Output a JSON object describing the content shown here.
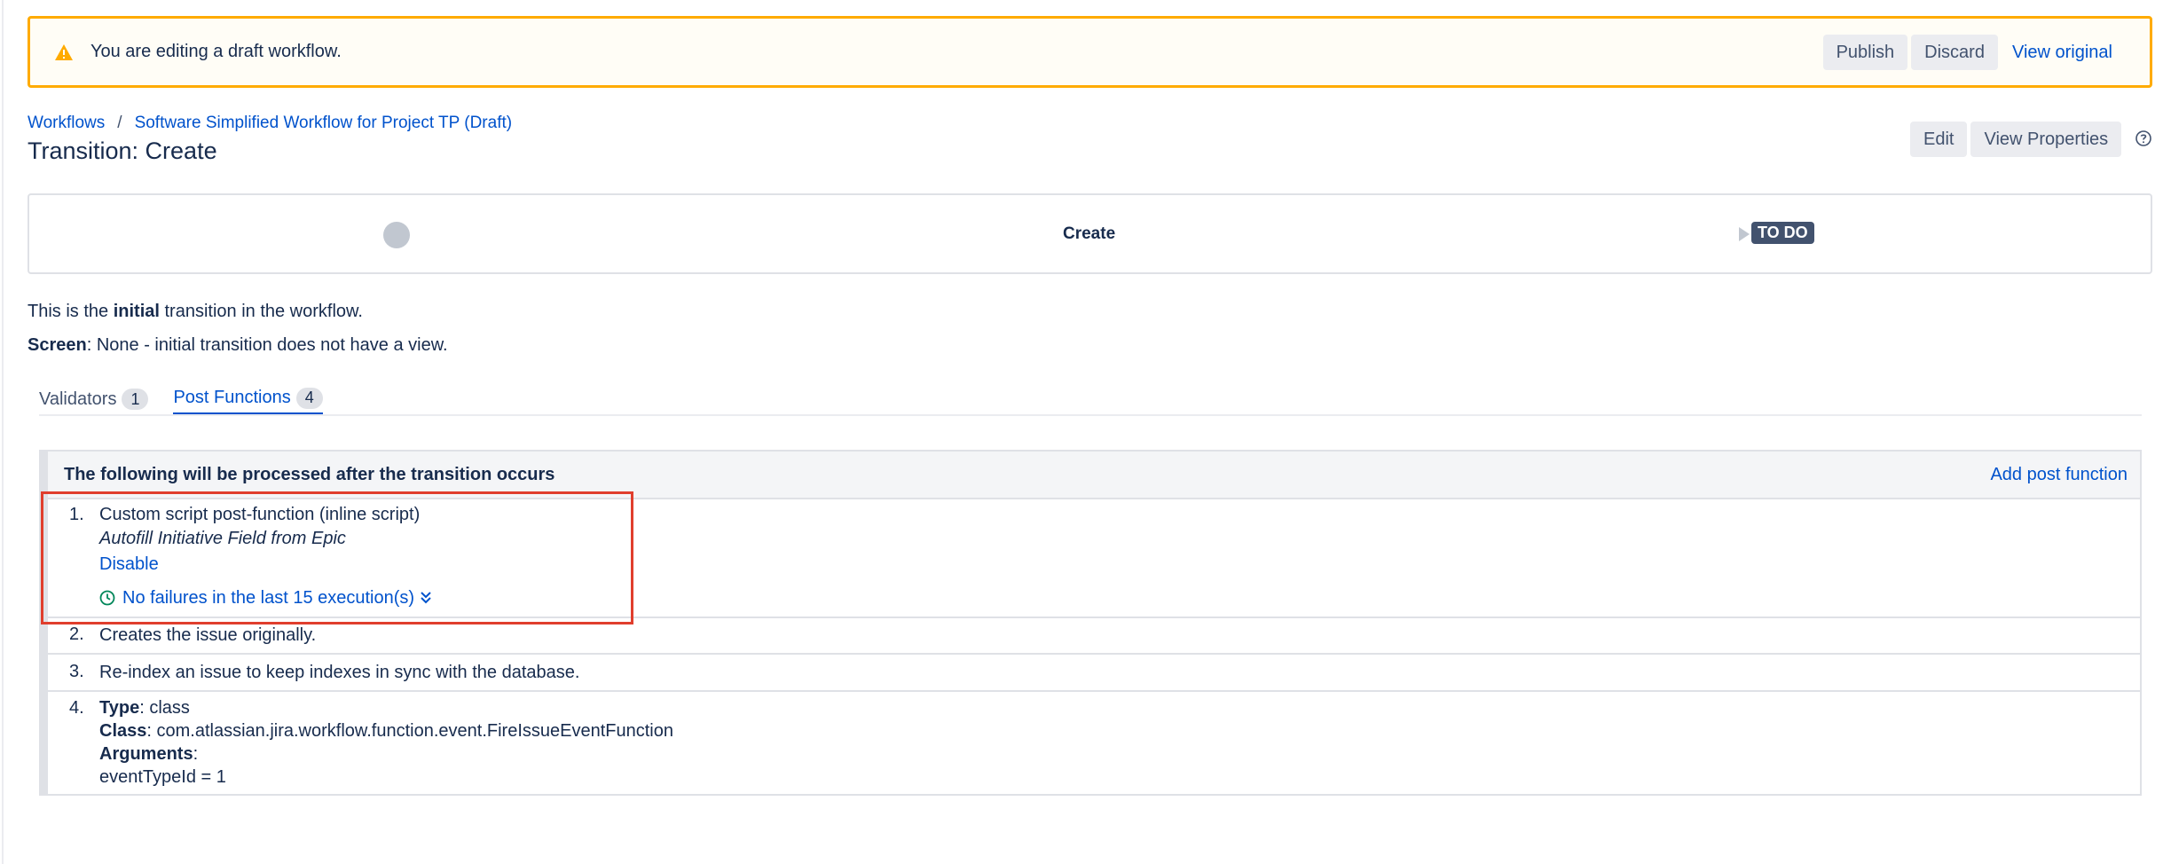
{
  "banner": {
    "message": "You are editing a draft workflow.",
    "publish_label": "Publish",
    "discard_label": "Discard",
    "view_original_label": "View original"
  },
  "breadcrumb": {
    "root": "Workflows",
    "separator": "/",
    "workflow": "Software Simplified Workflow for Project TP (Draft)"
  },
  "page": {
    "title": "Transition: Create",
    "edit_label": "Edit",
    "view_properties_label": "View Properties"
  },
  "diagram": {
    "transition_name": "Create",
    "target_status": "TO DO"
  },
  "description": {
    "line1_prefix": "This is the ",
    "line1_bold": "initial",
    "line1_suffix": " transition in the workflow.",
    "line2_label": "Screen",
    "line2_text": ": None - initial transition does not have a view."
  },
  "tabs": [
    {
      "label": "Validators",
      "count": "1",
      "active": false
    },
    {
      "label": "Post Functions",
      "count": "4",
      "active": true
    }
  ],
  "post_functions": {
    "header": "The following will be processed after the transition occurs",
    "add_label": "Add post function",
    "items": [
      {
        "number": "1.",
        "title": "Custom script post-function (inline script)",
        "subtitle": "Autofill Initiative Field from Epic",
        "action": "Disable",
        "status": "No failures in the last 15 execution(s)"
      },
      {
        "number": "2.",
        "text": "Creates the issue originally."
      },
      {
        "number": "3.",
        "text": "Re-index an issue to keep indexes in sync with the database."
      },
      {
        "number": "4.",
        "type_label": "Type",
        "type_value": ": class",
        "class_label": "Class",
        "class_value": ": com.atlassian.jira.workflow.function.event.FireIssueEventFunction",
        "arguments_label": "Arguments",
        "arguments_suffix": ":",
        "argument": "eventTypeId = 1"
      }
    ]
  },
  "colors": {
    "warning": "#ffab00",
    "link": "#0052cc",
    "highlight": "#e03e2d",
    "success": "#00875a",
    "lozenge": "#42526e"
  }
}
